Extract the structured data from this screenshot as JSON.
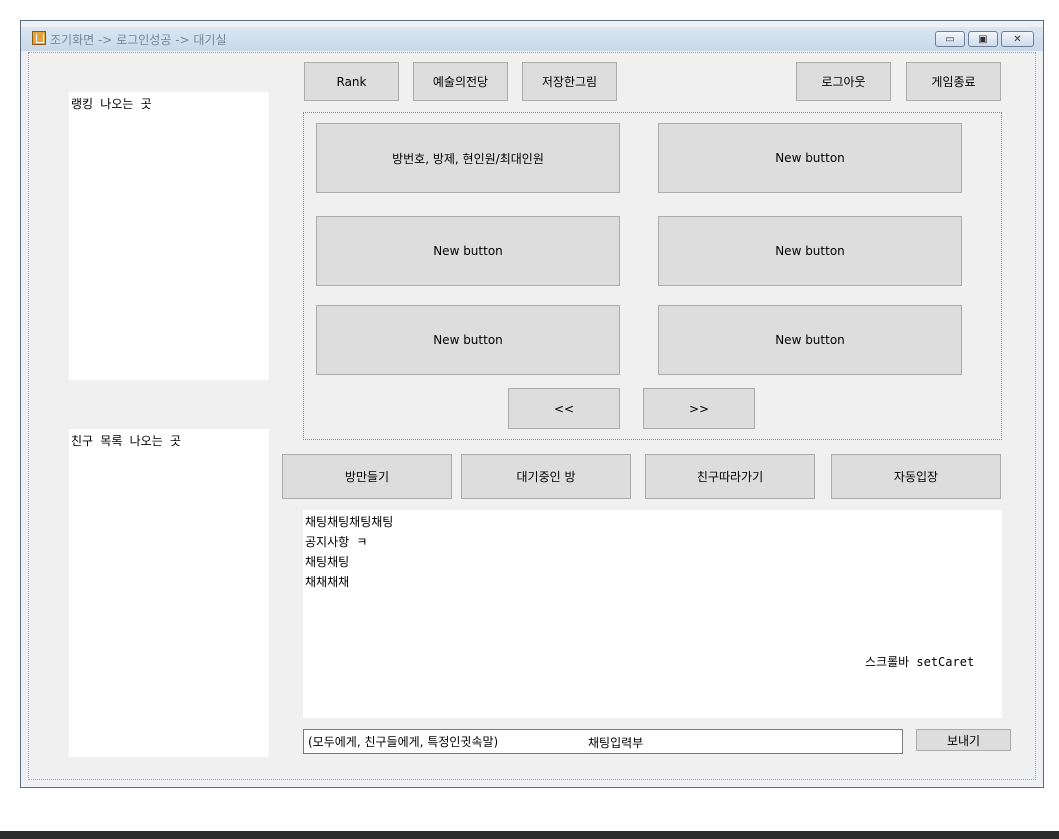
{
  "window": {
    "title": "조기화면 -> 로그인성공 -> 대기실",
    "min_icon": "▭",
    "max_icon": "▣",
    "close_icon": "✕"
  },
  "left": {
    "ranking_text": "랭킹 나오는 곳",
    "friends_text": "친구 목록 나오는 곳"
  },
  "top_buttons": {
    "rank": "Rank",
    "hall_of_fame": "예술의전당",
    "saved_drawings": "저장한그림",
    "logout": "로그아웃",
    "quit": "게임종료"
  },
  "rooms": {
    "room1": "방번호, 방제, 현인원/최대인원",
    "room2": "New button",
    "room3": "New button",
    "room4": "New button",
    "room5": "New button",
    "room6": "New button",
    "prev": "<<",
    "next": ">>"
  },
  "actions": {
    "create_room": "방만들기",
    "waiting_rooms": "대기중인 방",
    "follow_friend": "친구따라가기",
    "auto_join": "자동입장"
  },
  "chat": {
    "lines": [
      "채팅채팅채팅채팅",
      "공지사항 ㅋ",
      "채팅채팅",
      "채채채채"
    ],
    "scroll_note": "스크롤바 setCaret",
    "input_value": "(모두에게, 친구들에게, 특정인귓속말)",
    "input_hint": "채팅입력부",
    "send": "보내기"
  }
}
